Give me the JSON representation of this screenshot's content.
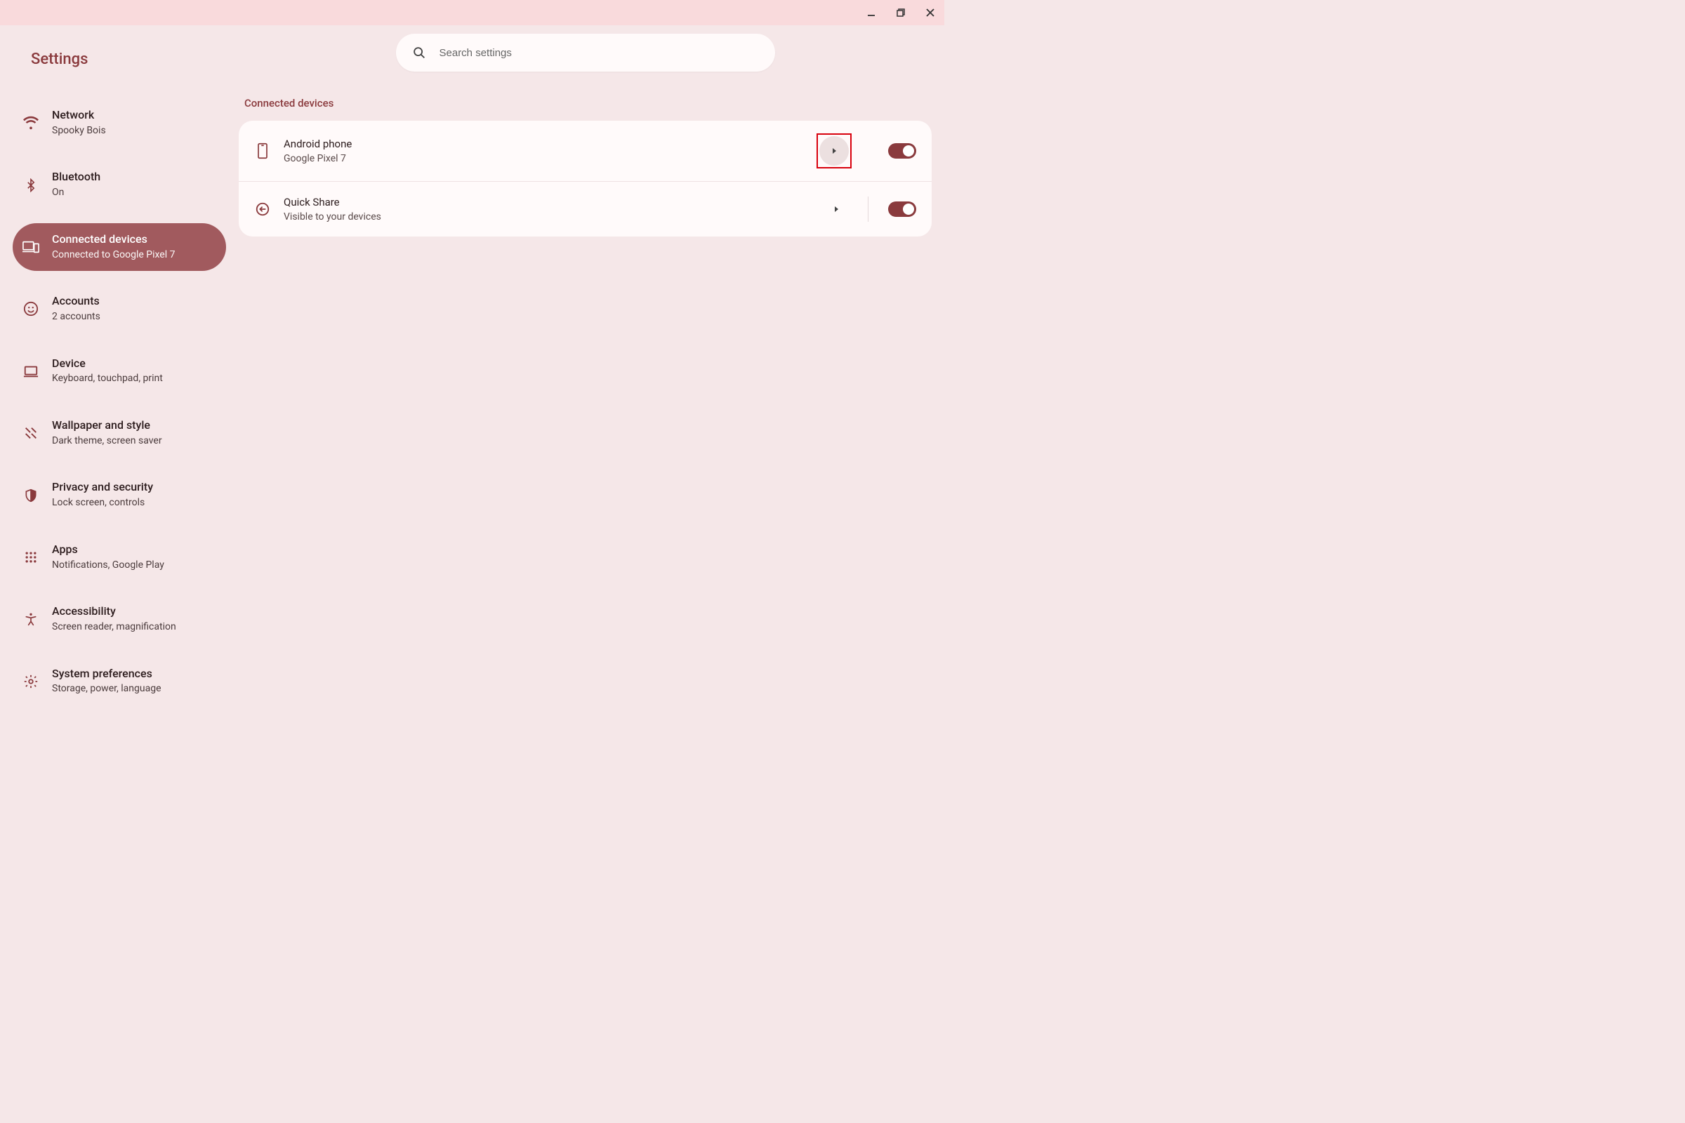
{
  "app_title": "Settings",
  "search": {
    "placeholder": "Search settings"
  },
  "sidebar": {
    "items": [
      {
        "title": "Network",
        "sub": "Spooky Bois",
        "icon": "wifi"
      },
      {
        "title": "Bluetooth",
        "sub": "On",
        "icon": "bluetooth"
      },
      {
        "title": "Connected devices",
        "sub": "Connected to Google Pixel 7",
        "icon": "devices",
        "selected": true
      },
      {
        "title": "Accounts",
        "sub": "2 accounts",
        "icon": "account"
      },
      {
        "title": "Device",
        "sub": "Keyboard, touchpad, print",
        "icon": "laptop"
      },
      {
        "title": "Wallpaper and style",
        "sub": "Dark theme, screen saver",
        "icon": "brush"
      },
      {
        "title": "Privacy and security",
        "sub": "Lock screen, controls",
        "icon": "shield"
      },
      {
        "title": "Apps",
        "sub": "Notifications, Google Play",
        "icon": "apps"
      },
      {
        "title": "Accessibility",
        "sub": "Screen reader, magnification",
        "icon": "a11y"
      },
      {
        "title": "System preferences",
        "sub": "Storage, power, language",
        "icon": "gear"
      }
    ]
  },
  "section": {
    "title": "Connected devices",
    "rows": [
      {
        "title": "Android phone",
        "sub": "Google Pixel 7",
        "icon": "phone",
        "chevron_bg": true,
        "highlighted": true,
        "toggle": true,
        "divider": false
      },
      {
        "title": "Quick Share",
        "sub": "Visible to your devices",
        "icon": "share",
        "chevron_bg": false,
        "toggle": true,
        "divider": true
      }
    ]
  }
}
